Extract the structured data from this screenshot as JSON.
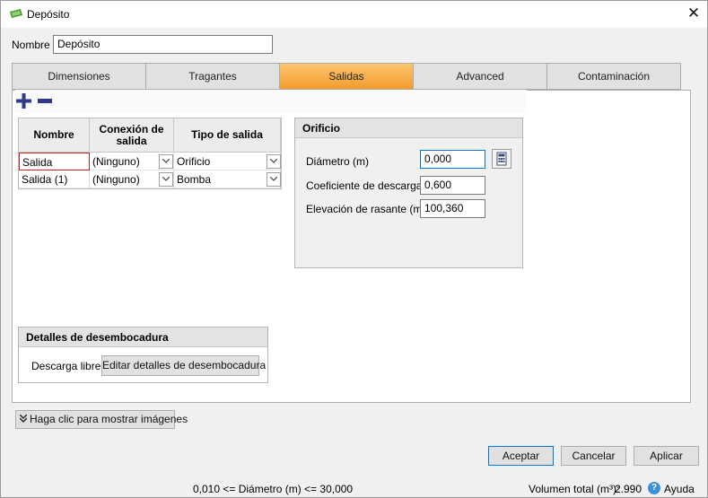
{
  "window": {
    "title": "Depósito",
    "close_glyph": "✕",
    "icon": "reservoir-icon"
  },
  "name_field": {
    "label": "Nombre",
    "value": "Depósito"
  },
  "tabs": [
    {
      "label": "Dimensiones",
      "active": false
    },
    {
      "label": "Tragantes",
      "active": false
    },
    {
      "label": "Salidas",
      "active": true
    },
    {
      "label": "Advanced",
      "active": false
    },
    {
      "label": "Contaminación",
      "active": false
    }
  ],
  "toolbar": {
    "add_icon": "plus-icon",
    "remove_icon": "minus-icon"
  },
  "outlets_table": {
    "headers": [
      "Nombre",
      "Conexión de salida",
      "Tipo de salida"
    ],
    "rows": [
      {
        "name": "Salida",
        "connection": "(Ninguno)",
        "type": "Orificio"
      },
      {
        "name": "Salida (1)",
        "connection": "(Ninguno)",
        "type": "Bomba"
      }
    ]
  },
  "orifice": {
    "title": "Orificio",
    "diameter_label": "Diámetro (m)",
    "diameter_value": "0,000",
    "discharge_coef_label": "Coeficiente de descarga",
    "discharge_coef_value": "0,600",
    "elevation_label": "Elevación de rasante (m)",
    "elevation_value": "100,360"
  },
  "outfall_details": {
    "title": "Detalles de desembocadura",
    "discharge_type": "Descarga libre",
    "edit_button": "Editar detalles de desembocadura"
  },
  "show_images_button": "Haga clic para mostrar imágenes",
  "buttons": {
    "accept": "Aceptar",
    "cancel": "Cancelar",
    "apply": "Aplicar"
  },
  "status": {
    "range_hint": "0,010 <= Diámetro (m) <= 30,000",
    "total_volume_label": "Volumen total (m³):",
    "total_volume_value": "2.990",
    "help_label": "Ayuda"
  },
  "colors": {
    "active_tab": "#f7a63a",
    "focus_border": "#0078d7",
    "invalid_cell_border": "#d41f1f"
  }
}
